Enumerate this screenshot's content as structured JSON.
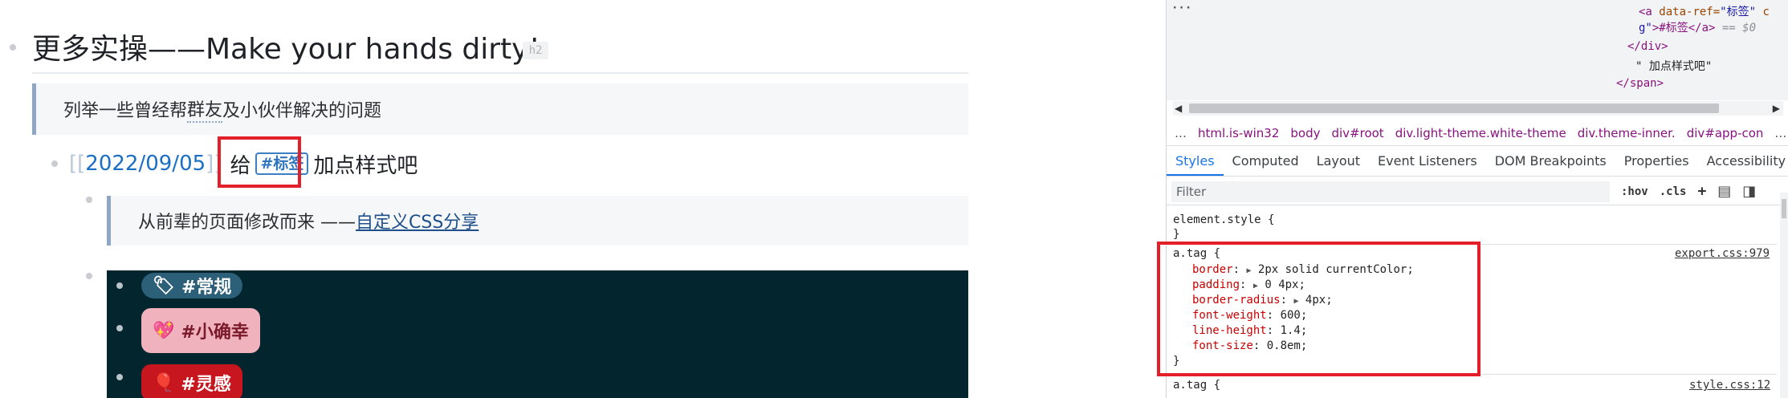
{
  "editor": {
    "heading": "更多实操——Make your hands dirty!",
    "heading_badge": "h2",
    "quote1": {
      "before": "列举一些曾经帮",
      "underlined": "群友",
      "after": "及小伙伴解决的问题"
    },
    "journal": {
      "open_bracket": "[[",
      "date": "2022/09/05",
      "close_bracket": "]]",
      "give": "给",
      "tag": "#标签",
      "after": "加点样式吧"
    },
    "quote2": {
      "text": "从前辈的页面修改而来 —— ",
      "link": "自定义CSS分享"
    },
    "pills": [
      {
        "emoji": "🏷",
        "label": "#常规"
      },
      {
        "emoji": "💖",
        "label": "#小确幸"
      },
      {
        "emoji": "🎈",
        "label": "#灵感"
      }
    ]
  },
  "devtools": {
    "dom": {
      "more": "···",
      "line1_tag_open": "<a ",
      "line1_attr": "data-ref=",
      "line1_val": "\"标签\"",
      "line1_tail": " c",
      "line2_val": "g\"",
      "line2_text": ">#标签</a>",
      "line2_eq": " == $0",
      "line3": "</div>",
      "line4": "\" 加点样式吧\"",
      "line5": "</span>"
    },
    "breadcrumb": [
      "…",
      "html.is-win32",
      "body",
      "div#root",
      "div.light-theme.white-theme",
      "div.theme-inner.",
      "div#app-con",
      "…"
    ],
    "tabs": [
      "Styles",
      "Computed",
      "Layout",
      "Event Listeners",
      "DOM Breakpoints",
      "Properties",
      "Accessibility"
    ],
    "active_tab": "Styles",
    "filter_placeholder": "Filter",
    "filter_tools": [
      ":hov",
      ".cls",
      "+"
    ],
    "element_style": {
      "selector": "element.style {",
      "close": "}"
    },
    "rule1": {
      "selector": "a.tag {",
      "source": "export.css:979",
      "props": [
        {
          "name": "border",
          "value": "2px solid currentColor;",
          "expandable": true
        },
        {
          "name": "padding",
          "value": "0 4px;",
          "expandable": true
        },
        {
          "name": "border-radius",
          "value": "4px;",
          "expandable": true
        },
        {
          "name": "font-weight",
          "value": "600;",
          "expandable": false
        },
        {
          "name": "line-height",
          "value": "1.4;",
          "expandable": false
        },
        {
          "name": "font-size",
          "value": "0.8em;",
          "expandable": false
        }
      ],
      "close": "}"
    },
    "rule2": {
      "selector": "a.tag {",
      "source": "style.css:12"
    }
  },
  "colors": {
    "highlight_box": "#e3202a",
    "tag_blue": "#2f74bf",
    "dark_block": "#03252e",
    "css_prop": "#c80000",
    "active_tab": "#1a73e8"
  }
}
